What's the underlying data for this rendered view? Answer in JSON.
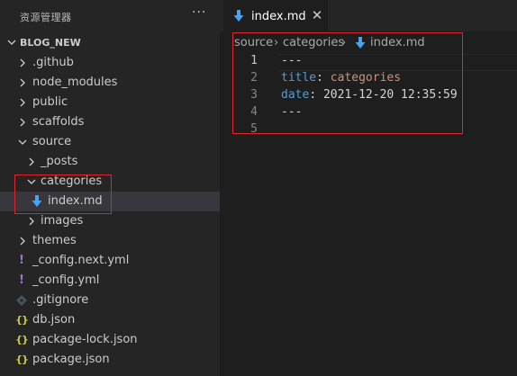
{
  "sidebar": {
    "title": "资源管理器",
    "more_label": "···",
    "section_label": "BLOG_NEW",
    "items": [
      {
        "label": ".github",
        "type": "folder",
        "state": "collapsed"
      },
      {
        "label": "node_modules",
        "type": "folder",
        "state": "collapsed"
      },
      {
        "label": "public",
        "type": "folder",
        "state": "collapsed"
      },
      {
        "label": "scaffolds",
        "type": "folder",
        "state": "collapsed"
      },
      {
        "label": "source",
        "type": "folder",
        "state": "expanded"
      },
      {
        "label": "_posts",
        "type": "folder",
        "state": "collapsed"
      },
      {
        "label": "categories",
        "type": "folder",
        "state": "expanded"
      },
      {
        "label": "index.md",
        "type": "markdown-file",
        "state": "selected"
      },
      {
        "label": "images",
        "type": "folder",
        "state": "collapsed"
      },
      {
        "label": "themes",
        "type": "folder",
        "state": "collapsed"
      },
      {
        "label": "_config.next.yml",
        "type": "yaml-file"
      },
      {
        "label": "_config.yml",
        "type": "yaml-file"
      },
      {
        "label": ".gitignore",
        "type": "git-file"
      },
      {
        "label": "db.json",
        "type": "json-file"
      },
      {
        "label": "package-lock.json",
        "type": "json-file"
      },
      {
        "label": "package.json",
        "type": "json-file"
      }
    ]
  },
  "editor": {
    "tab": {
      "label": "index.md",
      "close_label": "✕"
    },
    "breadcrumb": [
      "source",
      "categories",
      "index.md"
    ],
    "breadcrumb_separator": "›",
    "lines": [
      {
        "number": "1",
        "parts": [
          {
            "text": "---",
            "kind": "dash"
          }
        ]
      },
      {
        "number": "2",
        "parts": [
          {
            "text": "title",
            "kind": "key"
          },
          {
            "text": ": ",
            "kind": "dash"
          },
          {
            "text": "categories",
            "kind": "val"
          }
        ]
      },
      {
        "number": "3",
        "parts": [
          {
            "text": "date",
            "kind": "key"
          },
          {
            "text": ": 2021-12-20 12:35:59",
            "kind": "dash"
          }
        ]
      },
      {
        "number": "4",
        "parts": [
          {
            "text": "---",
            "kind": "dash"
          }
        ]
      },
      {
        "number": "5",
        "parts": []
      }
    ]
  },
  "colors": {
    "sidebar_bg": "#252526",
    "editor_bg": "#1e1e1e",
    "highlight_box": "#e0242b",
    "markdown_icon": "#42a5f5",
    "yaml_icon": "#a074c4",
    "json_icon": "#cbcb41",
    "git_icon": "#41535b"
  }
}
